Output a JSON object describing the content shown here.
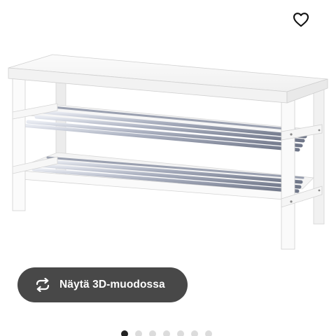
{
  "favorite": {
    "icon": "heart-outline-icon"
  },
  "view3d_button": {
    "label": "Näytä 3D-muodossa",
    "icon": "rotate-arrows-icon",
    "background": "#484848",
    "text_color": "#ffffff"
  },
  "product_image": {
    "icon": "shoe-bench-image"
  },
  "carousel": {
    "total": 7,
    "active_index": 0
  }
}
